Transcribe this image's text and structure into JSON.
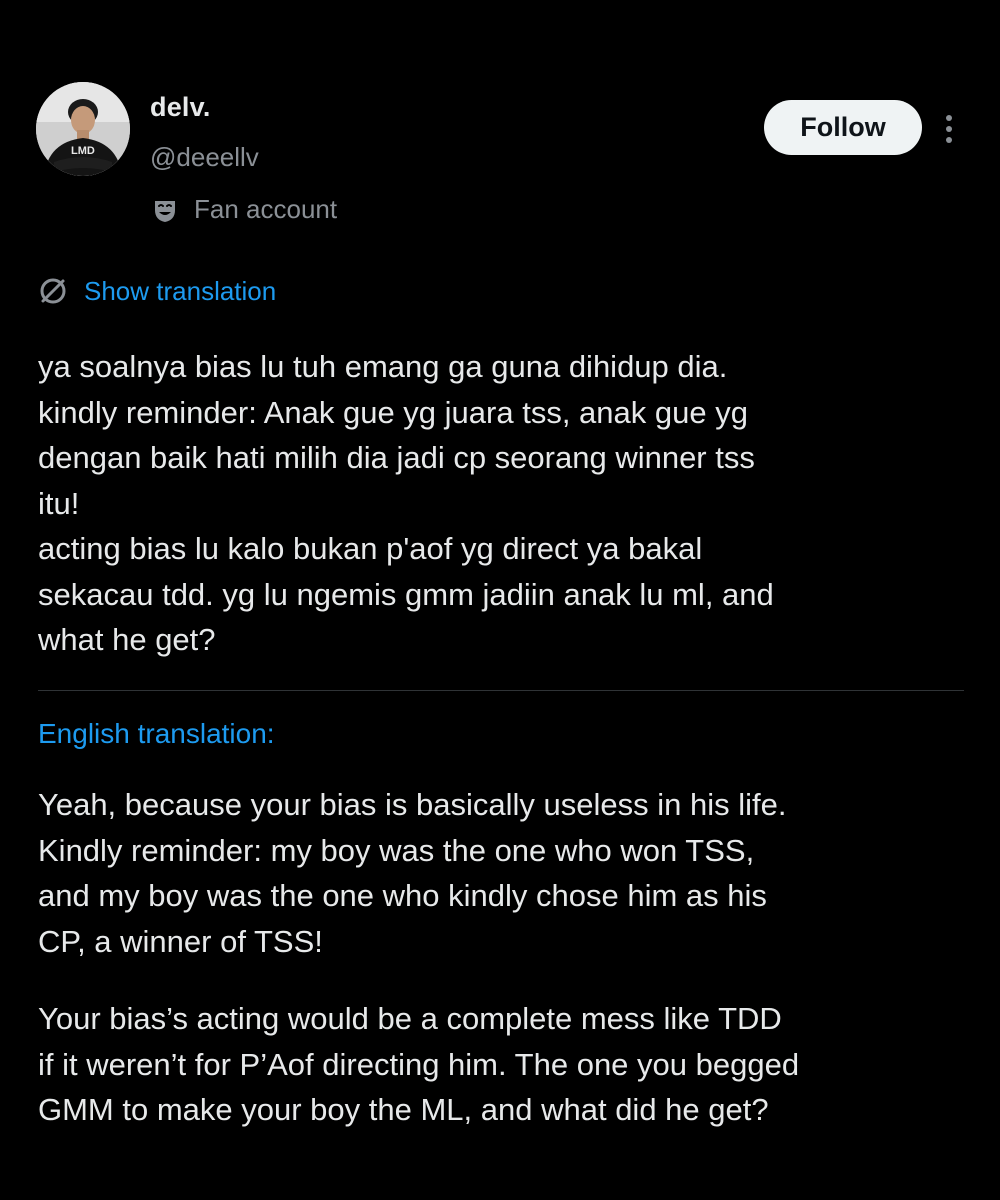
{
  "user": {
    "display_name": "delv.",
    "handle": "@deeellv",
    "label": "Fan account",
    "label_icon": "fan-mask-icon"
  },
  "actions": {
    "follow_label": "Follow",
    "more_icon": "more-vertical-icon"
  },
  "translation_link": {
    "label": "Show translation",
    "icon": "translate-icon"
  },
  "tweet": {
    "lines": [
      "ya soalnya bias lu tuh emang ga guna dihidup dia.",
      "kindly reminder: Anak gue yg juara tss, anak gue yg",
      "dengan baik hati milih dia jadi cp seorang winner tss",
      "itu!",
      "acting bias lu kalo bukan p'aof yg direct ya bakal",
      "sekacau tdd. yg lu ngemis gmm jadiin anak lu ml, and",
      "what he get?"
    ]
  },
  "english": {
    "heading": "English translation:",
    "paragraph1": [
      "Yeah, because your bias is basically useless in his life.",
      "Kindly reminder: my boy was the one who won TSS,",
      "and my boy was the one who kindly chose him as his",
      "CP, a winner of TSS!"
    ],
    "paragraph2": [
      "Your bias’s acting would be a complete mess like TDD",
      "if it weren’t for P’Aof directing him. The one you begged",
      "GMM to make your boy the ML, and what did he get?"
    ]
  },
  "colors": {
    "background": "#000000",
    "text": "#e7e9ea",
    "muted": "#8b9096",
    "accent": "#1d9bf0",
    "divider": "#2f3336"
  }
}
